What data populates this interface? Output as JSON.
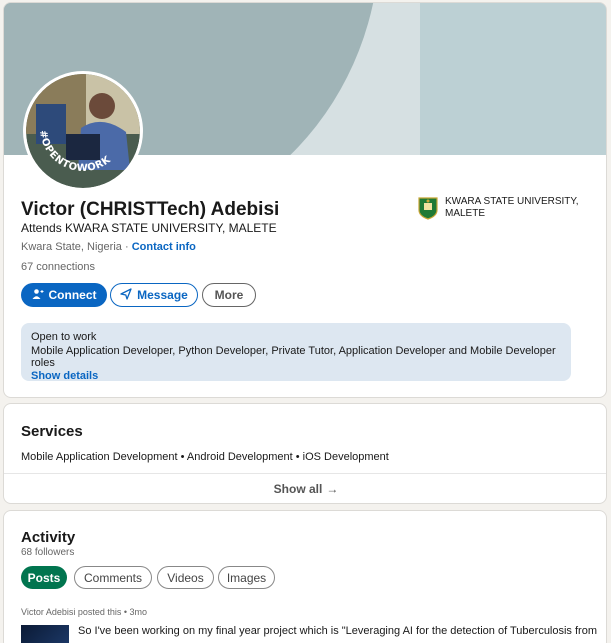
{
  "profile": {
    "avatar_badge": "#OPENTOWORK",
    "name": "Victor (CHRISTTech) Adebisi",
    "headline": "Attends KWARA STATE UNIVERSITY, MALETE",
    "location": "Kwara State, Nigeria",
    "separator": "·",
    "contact_label": "Contact info",
    "connections": "67 connections",
    "school_line1": "KWARA STATE UNIVERSITY,",
    "school_line2": "MALETE",
    "buttons": {
      "connect": "Connect",
      "message": "Message",
      "more": "More"
    },
    "open_to_work": {
      "title": "Open to work",
      "roles": "Mobile Application Developer, Python Developer, Private Tutor, Application Developer and Mobile Developer roles",
      "show_details": "Show details"
    }
  },
  "services": {
    "heading": "Services",
    "list": "Mobile Application Development • Android Development • iOS Development",
    "show_all": "Show all",
    "show_all_arrow": "→"
  },
  "activity": {
    "heading": "Activity",
    "followers": "68 followers",
    "tabs": [
      "Posts",
      "Comments",
      "Videos",
      "Images"
    ],
    "post_meta": "Victor Adebisi posted this • 3mo",
    "post_snippet": "So I've been working on my final year project which is \"Leveraging AI for the detection of Tuberculosis from"
  },
  "colors": {
    "accent": "#0a66c2",
    "open_to_work_green": "#01754f",
    "banner": "#a0b4b7"
  }
}
